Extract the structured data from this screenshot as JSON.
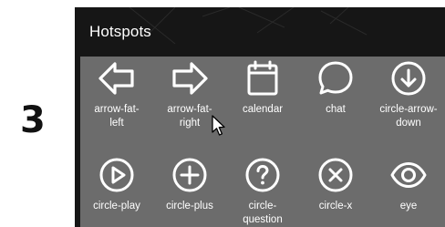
{
  "step": {
    "number": "3"
  },
  "panel": {
    "title": "Hotspots",
    "background": "#161616",
    "grid_background": "#6c6c6c",
    "icon_color": "#ffffff"
  },
  "hotspots": [
    {
      "label": "arrow-fat-\nleft",
      "icon": "arrow-fat-left-icon"
    },
    {
      "label": "arrow-fat-\nright",
      "icon": "arrow-fat-right-icon"
    },
    {
      "label": "calendar",
      "icon": "calendar-icon"
    },
    {
      "label": "chat",
      "icon": "chat-icon"
    },
    {
      "label": "circle-arrow-\ndown",
      "icon": "circle-arrow-down-icon"
    },
    {
      "label": "circle-play",
      "icon": "circle-play-icon"
    },
    {
      "label": "circle-plus",
      "icon": "circle-plus-icon"
    },
    {
      "label": "circle-\nquestion",
      "icon": "circle-question-icon"
    },
    {
      "label": "circle-x",
      "icon": "circle-x-icon"
    },
    {
      "label": "eye",
      "icon": "eye-icon"
    }
  ]
}
